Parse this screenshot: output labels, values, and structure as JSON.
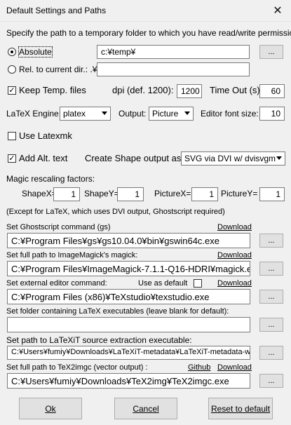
{
  "window": {
    "title": "Default Settings and Paths"
  },
  "temp": {
    "instruction": "Specify the path to a temporary folder to which you have read/write permissions:",
    "absolute_label": "Absolute",
    "absolute_value": "c:¥temp¥",
    "relative_label": "Rel. to current dir.: .¥",
    "relative_value": "",
    "keep_label": "Keep Temp. files",
    "keep_checked": true
  },
  "dpi": {
    "label": "dpi (def. 1200):",
    "value": "1200"
  },
  "timeout": {
    "label": "Time Out (s):",
    "value": "60"
  },
  "engine": {
    "label": "LaTeX Engine:",
    "value": "platex"
  },
  "output": {
    "label": "Output:",
    "value": "Picture"
  },
  "editor_font": {
    "label": "Editor font size:",
    "value": "10"
  },
  "latexmk": {
    "label": "Use Latexmk",
    "checked": false
  },
  "alt_text": {
    "label": "Add Alt. text",
    "checked": true
  },
  "shape_output": {
    "label": "Create Shape output as:",
    "value": "SVG via DVI w/ dvisvgm"
  },
  "rescale": {
    "title": "Magic rescaling factors:",
    "shape_x_label": "ShapeX=",
    "shape_x": "1",
    "shape_y_label": "ShapeY=",
    "shape_y": "1",
    "picture_x_label": "PictureX=",
    "picture_x": "1",
    "picture_y_label": "PictureY=",
    "picture_y": "1",
    "note": "(Except for LaTeX, which uses DVI output, Ghostscript required)"
  },
  "ghostscript": {
    "label": "Set Ghostscript command (gs)",
    "download": "Download",
    "value": "C:¥Program Files¥gs¥gs10.04.0¥bin¥gswin64c.exe"
  },
  "magick": {
    "label": "Set full path to ImageMagick's magick:",
    "download": "Download",
    "value": "C:¥Program Files¥ImageMagick-7.1.1-Q16-HDRI¥magick.exe"
  },
  "editor": {
    "label": "Set external editor command:",
    "default_label": "Use as default",
    "download": "Download",
    "value": "C:¥Program Files (x86)¥TeXstudio¥texstudio.exe"
  },
  "latex_folder": {
    "label": "Set folder containing LaTeX executables (leave blank for default):",
    "value": ""
  },
  "latexit": {
    "label": "Set path to LaTeXiT source extraction executable:",
    "value": "C:¥Users¥fumiy¥Downloads¥LaTeXiT-metadata¥LaTeXiT-metadata-win"
  },
  "tex2img": {
    "label": "Set full path to TeX2imgc (vector output) :",
    "github": "Github",
    "download": "Download",
    "value": "C:¥Users¥fumiy¥Downloads¥TeX2img¥TeX2imgc.exe"
  },
  "browse_label": "...",
  "buttons": {
    "ok": "Ok",
    "cancel": "Cancel",
    "reset": "Reset to default"
  }
}
